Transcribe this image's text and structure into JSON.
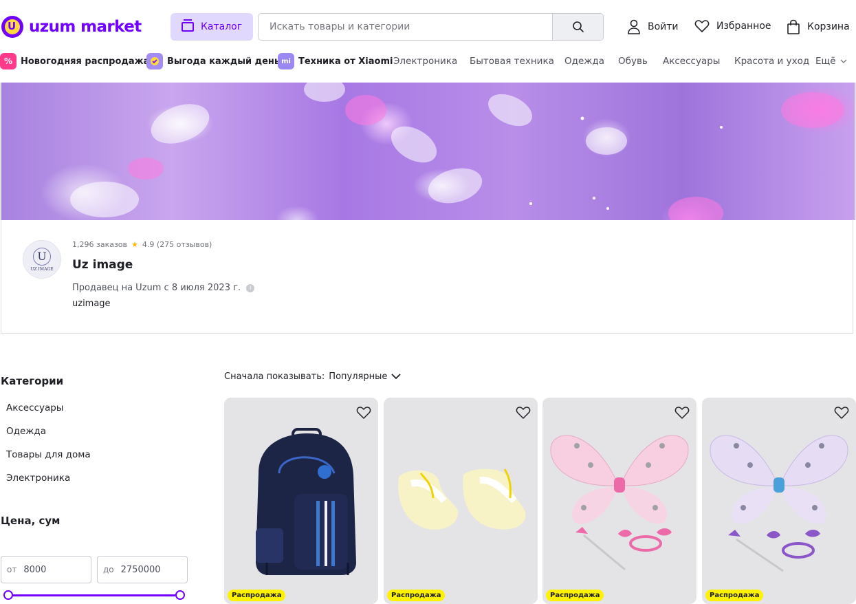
{
  "header": {
    "logo_text": "uzum market",
    "catalog_label": "Каталог",
    "search_placeholder": "Искать товары и категории",
    "login_label": "Войти",
    "favorites_label": "Избранное",
    "cart_label": "Корзина"
  },
  "nav": {
    "promo_items": [
      {
        "label": "Новогодняя распродажа",
        "icon": "percent-icon",
        "color": "#ff3a8a"
      },
      {
        "label": "Выгода каждый день",
        "icon": "tag-icon",
        "color": "#a48cf5"
      },
      {
        "label": "Техника от Xiaomi",
        "icon": "xiaomi-icon",
        "color": "#9c88f2"
      }
    ],
    "categories": [
      "Электроника",
      "Бытовая техника",
      "Одежда",
      "Обувь",
      "Аксессуары",
      "Красота и уход"
    ],
    "more_label": "Ещё"
  },
  "seller": {
    "orders": "1,296 заказов",
    "rating": "4.9 (275 отзывов)",
    "name": "Uz image",
    "since": "Продавец на Uzum с 8 июля 2023 г.",
    "handle": "uzimage",
    "avatar_letter": "U",
    "avatar_text": "UZ IMAGE"
  },
  "sidebar": {
    "categories_title": "Категории",
    "categories": [
      "Аксессуары",
      "Одежда",
      "Товары для дома",
      "Электроника"
    ],
    "price_title": "Цена, сум",
    "price_from_label": "от",
    "price_from": "8000",
    "price_to_label": "до",
    "price_to": "2750000"
  },
  "sort": {
    "label": "Сначала показывать:",
    "value": "Популярные"
  },
  "products": [
    {
      "badge": "Распродажа",
      "image": "backpack"
    },
    {
      "badge": "Распродажа",
      "image": "baby-booties"
    },
    {
      "badge": "Распродажа",
      "image": "pink-fairy-wings"
    },
    {
      "badge": "Распродажа",
      "image": "purple-fairy-wings"
    }
  ],
  "colors": {
    "brand": "#7000ff",
    "catalog_bg": "#e0d9fd",
    "sale_badge": "#fff200"
  }
}
